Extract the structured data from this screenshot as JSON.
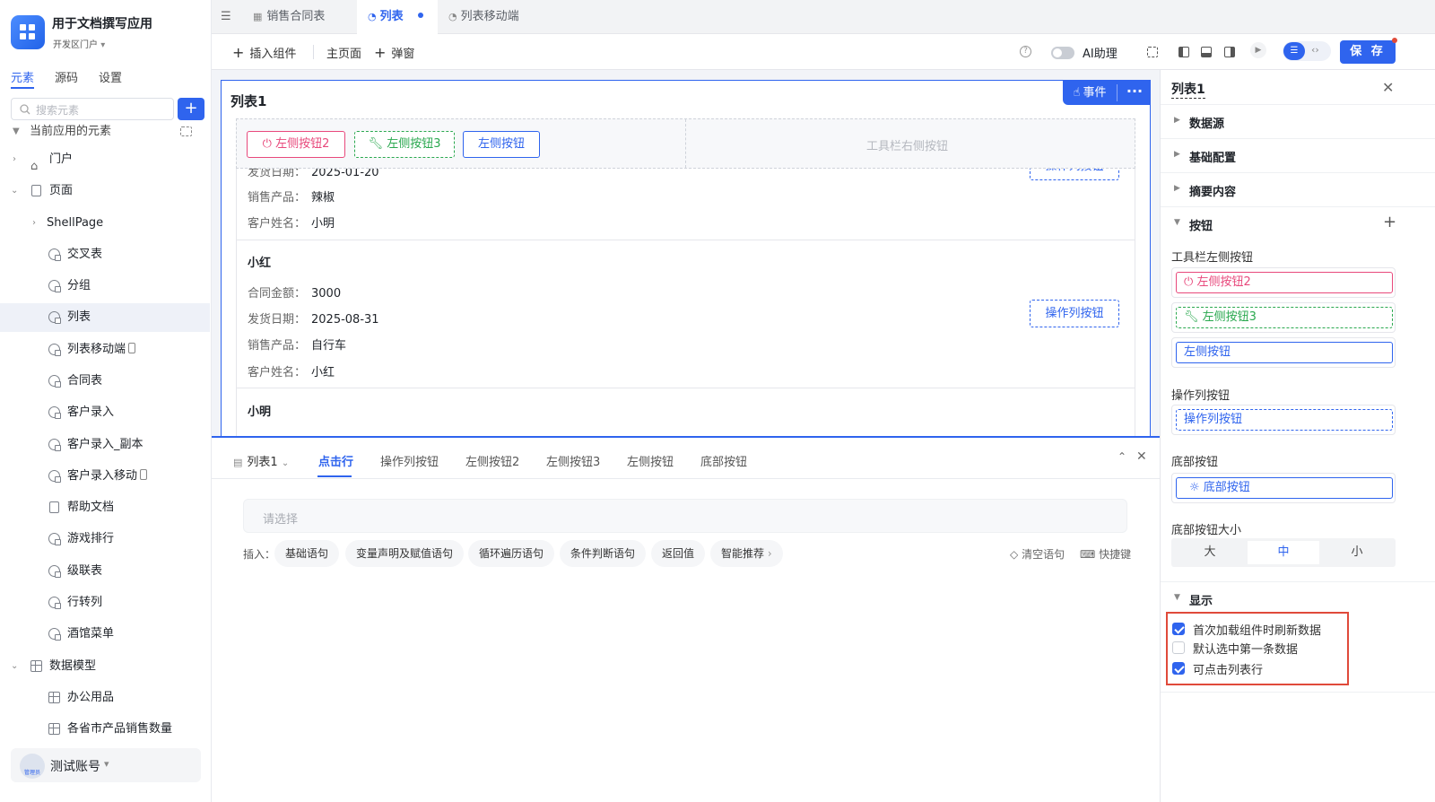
{
  "app": {
    "title": "用于文档撰写应用",
    "subtitle": "开发区门户"
  },
  "left_tabs": [
    "元素",
    "源码",
    "设置"
  ],
  "search": {
    "placeholder": "搜索元素"
  },
  "tree": {
    "root": "当前应用的元素",
    "portal": "门户",
    "pages": "页面",
    "shell": "ShellPage",
    "items": [
      "交叉表",
      "分组",
      "列表",
      "列表移动端",
      "合同表",
      "客户录入",
      "客户录入_副本",
      "客户录入移动",
      "帮助文档",
      "游戏排行",
      "级联表",
      "行转列",
      "酒馆菜单"
    ],
    "models": "数据模型",
    "model_items": [
      "办公用品",
      "各省市产品销售数量"
    ]
  },
  "user": {
    "name": "测试账号",
    "role": "管理员"
  },
  "page_tabs": [
    "销售合同表",
    "列表",
    "列表移动端"
  ],
  "toolbar": {
    "insert": "插入组件",
    "main_page": "主页面",
    "popup": "弹窗",
    "ai": "AI助理",
    "save": "保 存"
  },
  "list": {
    "title": "列表1",
    "event": "事件",
    "left_buttons": [
      "左侧按钮2",
      "左侧按钮3",
      "左侧按钮"
    ],
    "right_placeholder": "工具栏右侧按钮",
    "op_button": "操作列按钮",
    "rows": {
      "top": {
        "date_label": "发货日期：",
        "date": "2025-01-20",
        "product_label": "销售产品：",
        "product": "辣椒",
        "customer_label": "客户姓名：",
        "customer": "小明"
      },
      "mid": {
        "name": "小红",
        "amount_label": "合同金额：",
        "amount": "3000",
        "date_label": "发货日期：",
        "date": "2025-08-31",
        "product_label": "销售产品：",
        "product": "自行车",
        "customer_label": "客户姓名：",
        "customer": "小红"
      },
      "last": {
        "name": "小明"
      }
    }
  },
  "bottom": {
    "component": "列表1",
    "tabs": [
      "点击行",
      "操作列按钮",
      "左侧按钮2",
      "左侧按钮3",
      "左侧按钮",
      "底部按钮"
    ],
    "select_placeholder": "请选择",
    "insert_label": "插入：",
    "chips": [
      "基础语句",
      "变量声明及赋值语句",
      "循环遍历语句",
      "条件判断语句",
      "返回值",
      "智能推荐"
    ],
    "clear": "清空语句",
    "shortcut": "快捷键"
  },
  "right": {
    "title": "列表1",
    "sections": [
      "数据源",
      "基础配置",
      "摘要内容",
      "按钮"
    ],
    "toolbar_left_label": "工具栏左侧按钮",
    "toolbar_left_buttons": [
      "左侧按钮2",
      "左侧按钮3",
      "左侧按钮"
    ],
    "op_label": "操作列按钮",
    "op_button": "操作列按钮",
    "bottom_label": "底部按钮",
    "bottom_button": "底部按钮",
    "size_label": "底部按钮大小",
    "sizes": [
      "大",
      "中",
      "小"
    ],
    "display": "显示",
    "checks": [
      {
        "label": "首次加载组件时刷新数据",
        "checked": true
      },
      {
        "label": "默认选中第一条数据",
        "checked": false
      },
      {
        "label": "可点击列表行",
        "checked": true
      }
    ]
  },
  "colors": {
    "accent": "#2f64ee",
    "danger": "#e8497c",
    "success": "#2aa84f",
    "highlight": "#e04a3a"
  }
}
